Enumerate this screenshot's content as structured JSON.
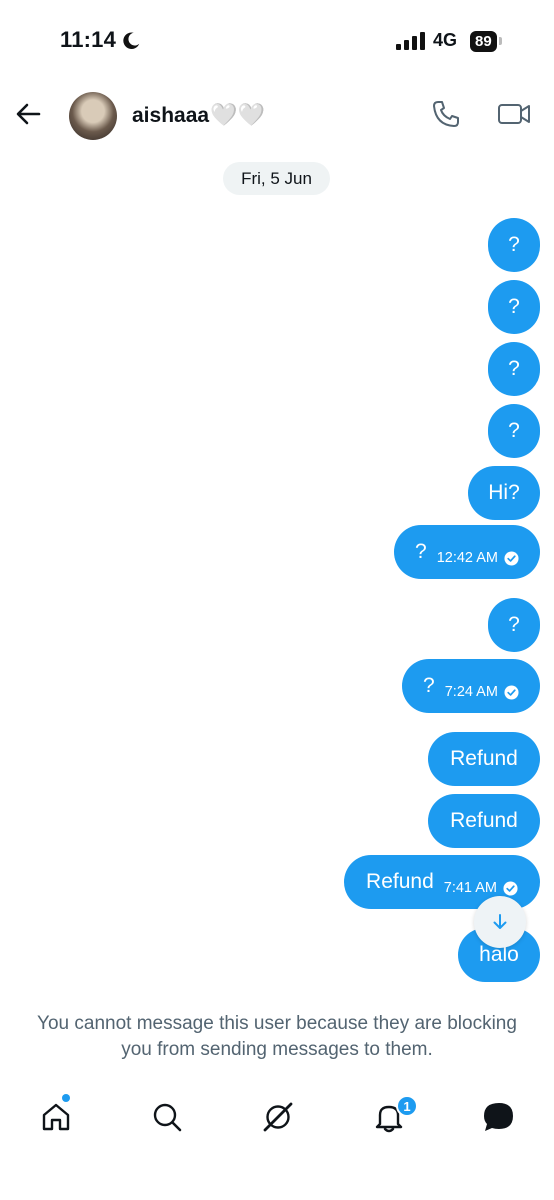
{
  "status_bar": {
    "time": "11:14",
    "network": "4G",
    "battery": "89"
  },
  "header": {
    "display_name": "aishaaa",
    "name_emoji": "🤍🤍"
  },
  "conversation": {
    "date_separator": "Fri, 5 Jun",
    "messages": [
      {
        "text": "?",
        "time": ""
      },
      {
        "text": "?",
        "time": ""
      },
      {
        "text": "?",
        "time": ""
      },
      {
        "text": "?",
        "time": ""
      },
      {
        "text": "Hi?",
        "time": ""
      },
      {
        "text": "?",
        "time": "12:42 AM"
      },
      {
        "text": "?",
        "time": ""
      },
      {
        "text": "?",
        "time": "7:24 AM"
      },
      {
        "text": "Refund",
        "time": ""
      },
      {
        "text": "Refund",
        "time": ""
      },
      {
        "text": "Refund",
        "time": "7:41 AM"
      },
      {
        "text": "halo",
        "time": ""
      }
    ]
  },
  "blocked_notice": "You cannot message this user because they are blocking you from sending messages to them.",
  "bottom_nav": {
    "items": [
      "home-icon",
      "search-icon",
      "grok-icon",
      "notifications-icon",
      "messages-icon"
    ],
    "notification_count": "1"
  },
  "colors": {
    "accent": "#1d9bf0",
    "muted_text": "#536471"
  }
}
